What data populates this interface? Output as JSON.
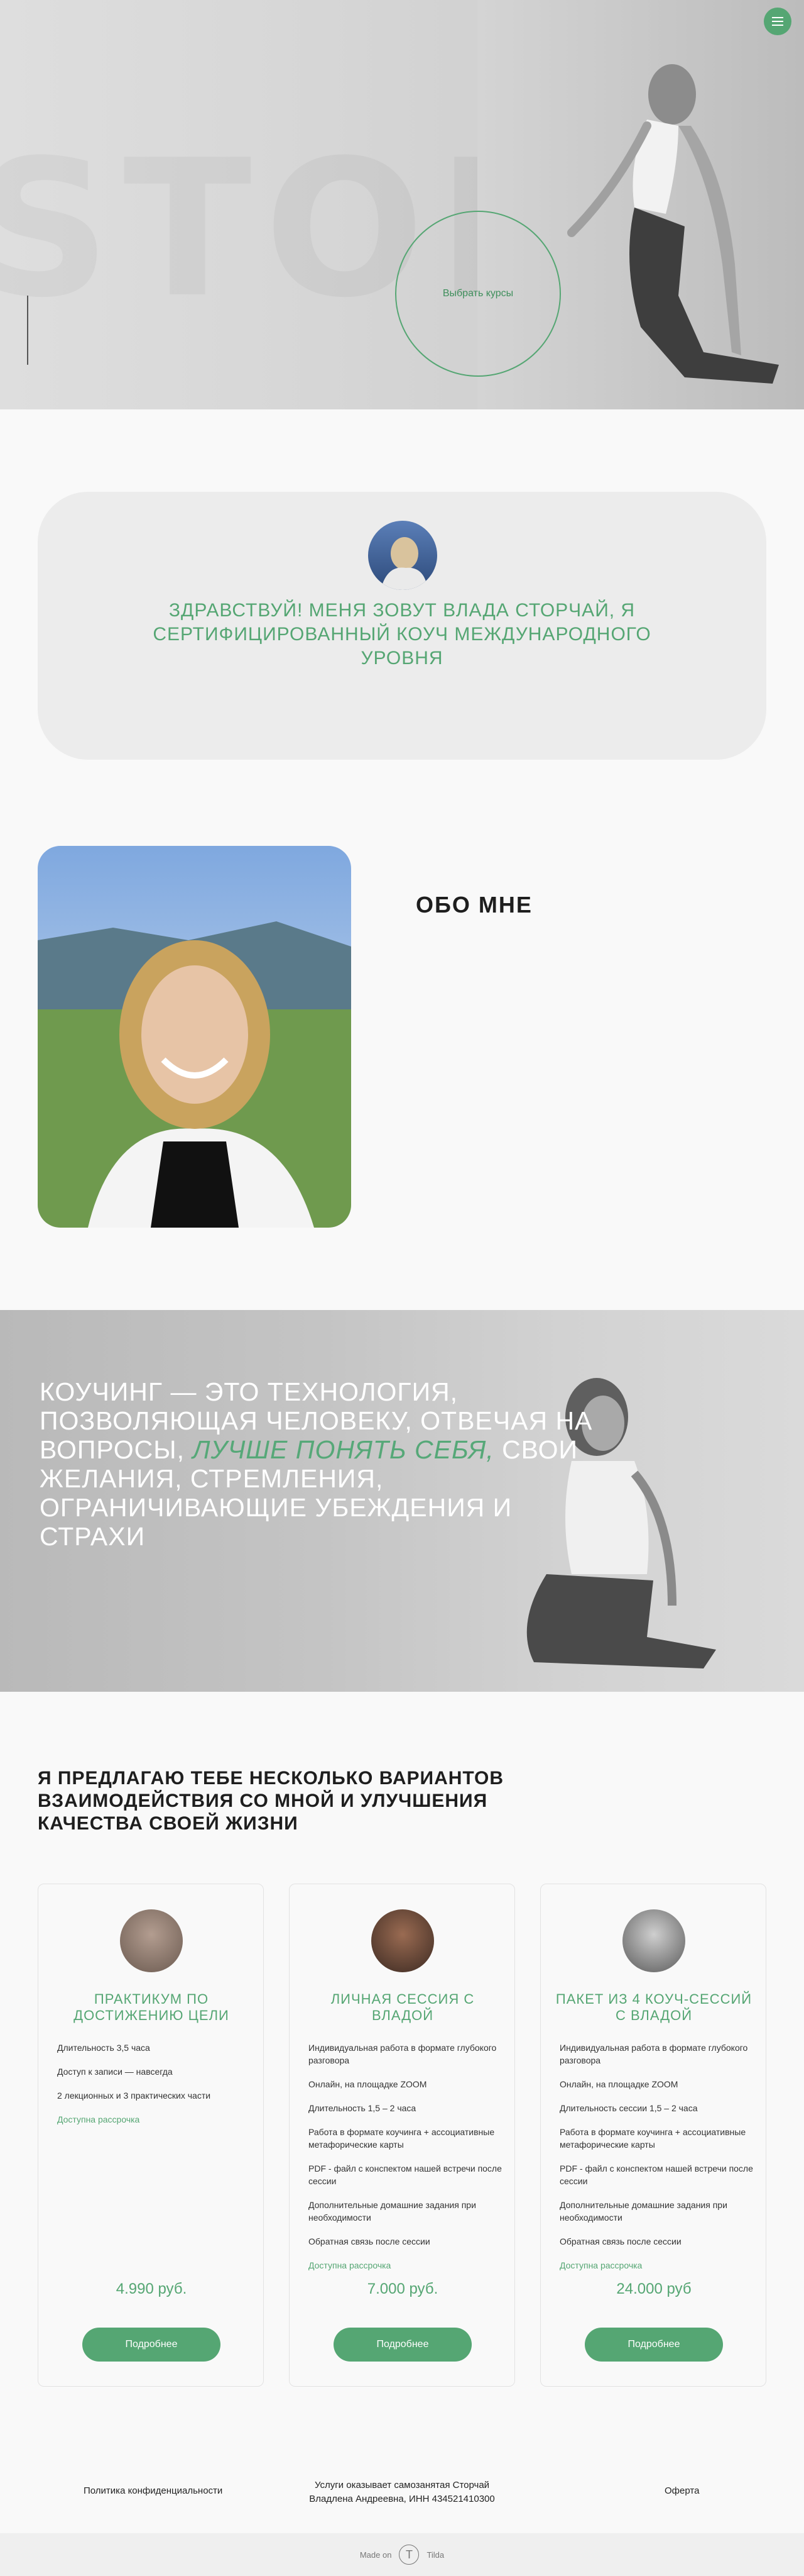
{
  "hero": {
    "bg_word": "STORCHAI",
    "cta_label": "Выбрать курсы",
    "menu_icon": "burger-menu-icon"
  },
  "greeting": {
    "text": "Здравствуй! Меня зовут Влада Сторчай, я сертифицированный коуч международного уровня"
  },
  "about": {
    "title": "ОБО МНЕ"
  },
  "coaching": {
    "line_before": "КОУЧИНГ — ЭТО ТЕХНОЛОГИЯ, ПОЗВОЛЯЮЩАЯ ЧЕЛОВЕКУ, ОТВЕЧАЯ НА ВОПРОСЫ, ",
    "highlight": "ЛУЧШЕ ПОНЯТЬ СЕБЯ,",
    "line_after": " СВОИ ЖЕЛАНИЯ, СТРЕМЛЕНИЯ, ОГРАНИЧИВАЮЩИЕ УБЕЖДЕНИЯ И СТРАХИ"
  },
  "offers": {
    "title": "Я предлагаю тебе несколько вариантов взаимодействия со мной и улучшения качества своей жизни",
    "cards": [
      {
        "title": "Практикум по достижению цели",
        "items": [
          "Длительность 3,5 часа",
          "Доступ к записи — навсегда",
          "2 лекционных и 3 практических части"
        ],
        "installment": "Доступна рассрочка",
        "price": "4.990 руб.",
        "button": "Подробнее"
      },
      {
        "title": "Личная сессия с Владой",
        "items": [
          "Индивидуальная работа в формате глубокого разговора",
          "Онлайн, на площадке ZOOM",
          "Длительность 1,5 – 2 часа",
          "Работа в формате коучинга + ассоциативные метафорические карты",
          "PDF - файл с конспектом нашей встречи после сессии",
          "Дополнительные домашние задания при необходимости",
          "Обратная связь после сессии"
        ],
        "installment": "Доступна рассрочка",
        "price": "7.000 руб.",
        "button": "Подробнее"
      },
      {
        "title": "Пакет из 4 коуч-сессий с Владой",
        "items": [
          "Индивидуальная работа в формате глубокого разговора",
          "Онлайн, на площадке ZOOM",
          "Длительность сессии 1,5 – 2 часа",
          "Работа в формате коучинга + ассоциативные метафорические карты",
          "PDF - файл с конспектом нашей встречи после сессии",
          "Дополнительные домашние задания при необходимости",
          "Обратная связь после сессии"
        ],
        "installment": "Доступна рассрочка",
        "price": "24.000 руб",
        "button": "Подробнее"
      }
    ]
  },
  "footer": {
    "privacy": "Политика конфиденциальности",
    "legal_line1": "Услуги оказывает самозанятая Сторчай",
    "legal_line2": "Владлена Андреевна, ИНН 434521410300",
    "offer": "Оферта",
    "made_on": "Made on",
    "tilda": "Tilda"
  },
  "colors": {
    "accent": "#55a673",
    "background": "#f9f9f9",
    "card_bg": "#ececec"
  }
}
